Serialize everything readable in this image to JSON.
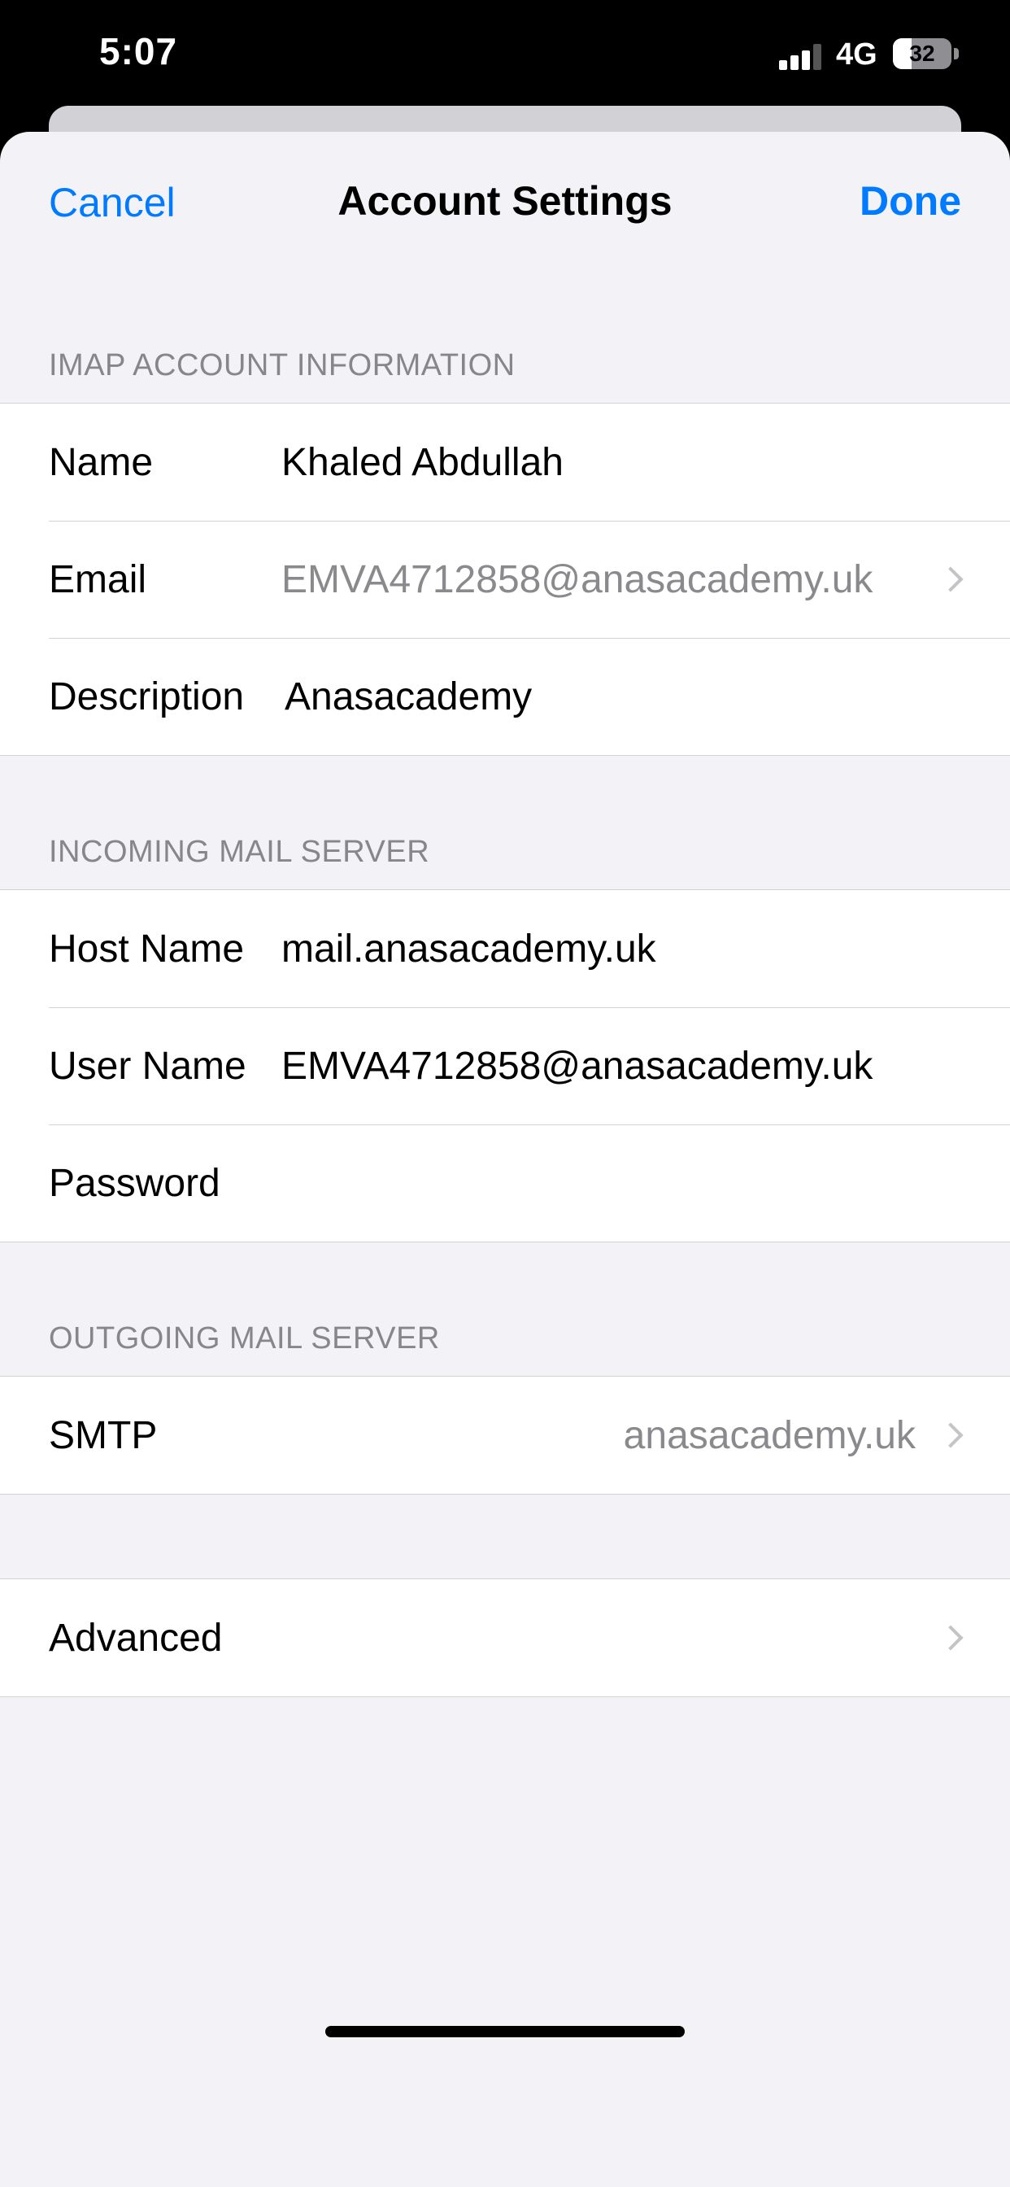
{
  "status_bar": {
    "time": "5:07",
    "network": "4G",
    "battery_level": "32",
    "battery_percent": 32,
    "signal_bars_active": 3,
    "signal_bars_total": 4,
    "signal_icon": "cellular-signal-icon",
    "battery_icon": "battery-icon"
  },
  "nav": {
    "cancel": "Cancel",
    "title": "Account Settings",
    "done": "Done"
  },
  "imap_section": {
    "header": "IMAP ACCOUNT INFORMATION",
    "name_label": "Name",
    "name_value": "Khaled Abdullah",
    "email_label": "Email",
    "email_value": "EMVA4712858@anasacademy.uk",
    "description_label": "Description",
    "description_value": "Anasacademy"
  },
  "incoming_section": {
    "header": "INCOMING MAIL SERVER",
    "host_label": "Host Name",
    "host_value": "mail.anasacademy.uk",
    "user_label": "User Name",
    "user_value": "EMVA4712858@anasacademy.uk",
    "password_label": "Password",
    "password_value": ""
  },
  "outgoing_section": {
    "header": "OUTGOING MAIL SERVER",
    "smtp_label": "SMTP",
    "smtp_value": "anasacademy.uk"
  },
  "advanced": {
    "label": "Advanced"
  },
  "colors": {
    "accent": "#007aff",
    "background": "#f2f2f7",
    "secondary_text": "#86868b"
  },
  "icons": {
    "chevron": "chevron-right-icon"
  }
}
